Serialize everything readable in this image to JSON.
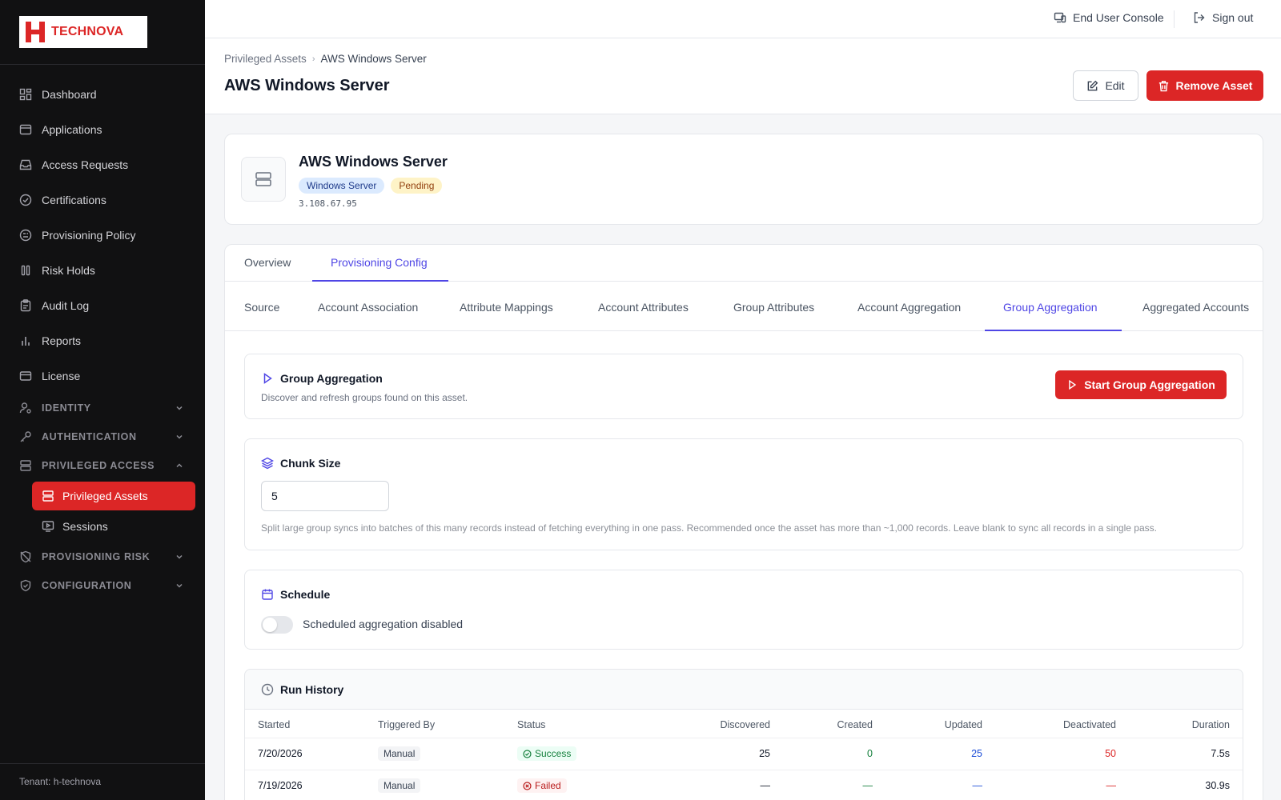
{
  "brand": {
    "name": "TECHNOVA",
    "color": "#dc2626"
  },
  "sidebar": {
    "items": [
      {
        "label": "Dashboard",
        "icon": "dashboard-icon"
      },
      {
        "label": "Applications",
        "icon": "window-icon"
      },
      {
        "label": "Access Requests",
        "icon": "inbox-icon"
      },
      {
        "label": "Certifications",
        "icon": "check-circle-icon"
      },
      {
        "label": "Provisioning Policy",
        "icon": "policy-icon"
      },
      {
        "label": "Risk Holds",
        "icon": "pause-icon"
      },
      {
        "label": "Audit Log",
        "icon": "clipboard-icon"
      },
      {
        "label": "Reports",
        "icon": "bar-chart-icon"
      },
      {
        "label": "License",
        "icon": "card-icon"
      }
    ],
    "groups": [
      {
        "label": "IDENTITY",
        "icon": "user-cog-icon",
        "expanded": false
      },
      {
        "label": "AUTHENTICATION",
        "icon": "key-icon",
        "expanded": false
      },
      {
        "label": "PRIVILEGED ACCESS",
        "icon": "server-icon",
        "expanded": true
      },
      {
        "label": "PROVISIONING RISK",
        "icon": "shield-off-icon",
        "expanded": false
      },
      {
        "label": "CONFIGURATION",
        "icon": "shield-check-icon",
        "expanded": false
      }
    ],
    "sub_items": [
      {
        "label": "Privileged Assets",
        "active": true
      },
      {
        "label": "Sessions",
        "active": false
      }
    ],
    "tenant": "Tenant: h-technova"
  },
  "topbar": {
    "end_user_console": "End User Console",
    "sign_out": "Sign out"
  },
  "header": {
    "breadcrumb": [
      "Privileged Assets",
      "AWS Windows Server"
    ],
    "title": "AWS Windows Server",
    "edit_label": "Edit",
    "remove_label": "Remove Asset"
  },
  "asset": {
    "name": "AWS Windows Server",
    "type_badge": "Windows Server",
    "status_badge": "Pending",
    "ip": "3.108.67.95"
  },
  "main_tabs": [
    "Overview",
    "Provisioning Config"
  ],
  "main_tab_active": 1,
  "sub_tabs": [
    "Source",
    "Account Association",
    "Attribute Mappings",
    "Account Attributes",
    "Group Attributes",
    "Account Aggregation",
    "Group Aggregation",
    "Aggregated Accounts"
  ],
  "sub_tab_active": 6,
  "group_aggregation": {
    "title": "Group Aggregation",
    "description": "Discover and refresh groups found on this asset.",
    "start_label": "Start Group Aggregation"
  },
  "chunk_size": {
    "title": "Chunk Size",
    "value": "5",
    "help": "Split large group syncs into batches of this many records instead of fetching everything in one pass. Recommended once the asset has more than ~1,000 records. Leave blank to sync all records in a single pass."
  },
  "schedule": {
    "title": "Schedule",
    "enabled": false,
    "label": "Scheduled aggregation disabled"
  },
  "run_history": {
    "title": "Run History",
    "columns": [
      "Started",
      "Triggered By",
      "Status",
      "Discovered",
      "Created",
      "Updated",
      "Deactivated",
      "Duration"
    ],
    "rows": [
      {
        "started": "7/20/2026",
        "triggered_by": "Manual",
        "status": "Success",
        "discovered": "25",
        "created": "0",
        "updated": "25",
        "deactivated": "50",
        "duration": "7.5s"
      },
      {
        "started": "7/19/2026",
        "triggered_by": "Manual",
        "status": "Failed",
        "discovered": "—",
        "created": "—",
        "updated": "—",
        "deactivated": "—",
        "duration": "30.9s"
      }
    ]
  },
  "colors": {
    "accent": "#4f46e5",
    "danger": "#dc2626",
    "sidebar_bg": "#111112",
    "success": "#15803d"
  }
}
